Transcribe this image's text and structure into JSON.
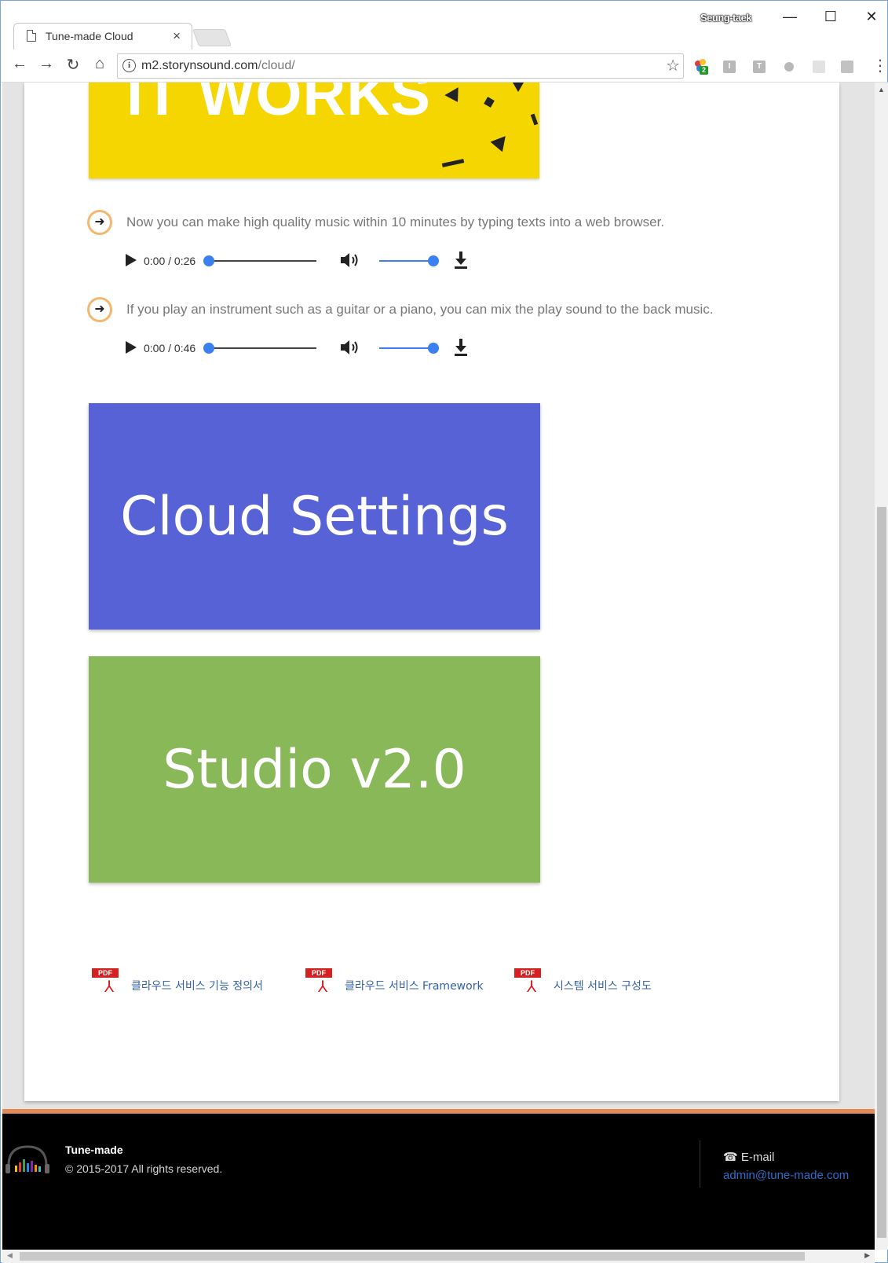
{
  "browser": {
    "tab_title": "Tune-made Cloud",
    "tab_close": "×",
    "profile_name": "Seung-taek",
    "window_controls": {
      "minimize": "—",
      "maximize": "☐",
      "close": "✕"
    },
    "nav": {
      "back": "←",
      "forward": "→",
      "reload": "↻",
      "home": "⌂"
    },
    "url_host": "m2.storynsound.com",
    "url_path": "/cloud/",
    "info_glyph": "i",
    "bookmark_glyph": "☆",
    "extension_badge": "2",
    "menu_glyph": "⋮",
    "icons": [
      "page-icon",
      "info-icon",
      "star-icon",
      "extension-icons",
      "menu-icon"
    ]
  },
  "hero": {
    "text": "IT WORKS",
    "background": "#f6d600"
  },
  "tracks": [
    {
      "arrow": "➜",
      "description": "Now you can make high quality music within 10 minutes by typing texts into a web browser.",
      "time": "0:00 / 0:26",
      "progress": 0,
      "volume": 1.0
    },
    {
      "arrow": "➜",
      "description": "If you play an instrument such as a guitar or a piano, you can mix the play sound to the back music.",
      "time": "0:00 / 0:46",
      "progress": 0,
      "volume": 1.0
    }
  ],
  "tiles": {
    "cloud_settings": {
      "label": "Cloud Settings",
      "color": "#5662d5"
    },
    "studio": {
      "label": "Studio v2.0",
      "color": "#89b858"
    }
  },
  "documents": {
    "pdf_tag": "PDF",
    "items": [
      {
        "label": "클라우드 서비스 기능 정의서"
      },
      {
        "label": "클라우드 서비스 Framework"
      },
      {
        "label": "시스템 서비스 구성도"
      }
    ]
  },
  "footer": {
    "brand": "Tune-made",
    "copyright": "© 2015-2017 All rights reserved.",
    "email_label": "☎ E-mail",
    "email": "admin@tune-made.com",
    "accent": "#e38b56"
  }
}
